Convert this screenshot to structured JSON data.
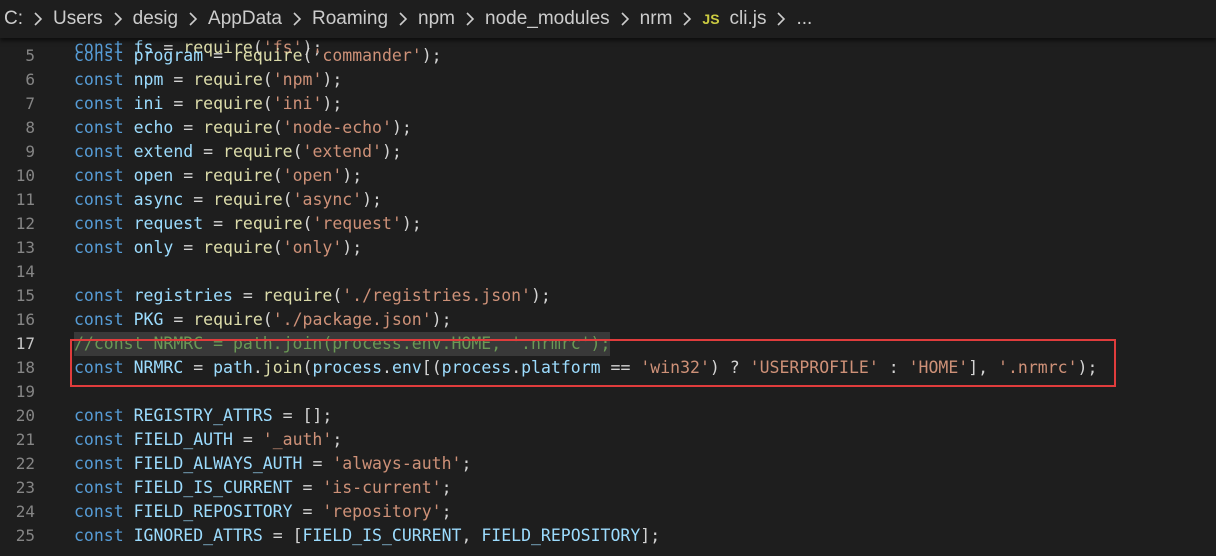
{
  "breadcrumb": {
    "segments": [
      "C:",
      "Users",
      "desig",
      "AppData",
      "Roaming",
      "npm",
      "node_modules",
      "nrm"
    ],
    "file_icon": "JS",
    "file_name": "cli.js",
    "trailing": "..."
  },
  "editor": {
    "active_line": 17,
    "highlighted_line": 18,
    "lines": [
      {
        "num": "5",
        "code": "const program = require('commander');"
      },
      {
        "num": "6",
        "code": "const npm = require('npm');"
      },
      {
        "num": "7",
        "code": "const ini = require('ini');"
      },
      {
        "num": "8",
        "code": "const echo = require('node-echo');"
      },
      {
        "num": "9",
        "code": "const extend = require('extend');"
      },
      {
        "num": "10",
        "code": "const open = require('open');"
      },
      {
        "num": "11",
        "code": "const async = require('async');"
      },
      {
        "num": "12",
        "code": "const request = require('request');"
      },
      {
        "num": "13",
        "code": "const only = require('only');"
      },
      {
        "num": "14",
        "code": ""
      },
      {
        "num": "15",
        "code": "const registries = require('./registries.json');"
      },
      {
        "num": "16",
        "code": "const PKG = require('./package.json');"
      },
      {
        "num": "17",
        "code": "//const NRMRC = path.join(process.env.HOME, '.nrmrc');"
      },
      {
        "num": "18",
        "code": "const NRMRC = path.join(process.env[(process.platform == 'win32') ? 'USERPROFILE' : 'HOME'], '.nrmrc');"
      },
      {
        "num": "19",
        "code": ""
      },
      {
        "num": "20",
        "code": "const REGISTRY_ATTRS = [];"
      },
      {
        "num": "21",
        "code": "const FIELD_AUTH = '_auth';"
      },
      {
        "num": "22",
        "code": "const FIELD_ALWAYS_AUTH = 'always-auth';"
      },
      {
        "num": "23",
        "code": "const FIELD_IS_CURRENT = 'is-current';"
      },
      {
        "num": "24",
        "code": "const FIELD_REPOSITORY = 'repository';"
      },
      {
        "num": "25",
        "code": "const IGNORED_ATTRS = [FIELD_IS_CURRENT, FIELD_REPOSITORY];"
      }
    ]
  },
  "colors": {
    "background": "#1e1e1e",
    "keyword": "#569cd6",
    "variable": "#9cdcfe",
    "function": "#dcdcaa",
    "string": "#ce9178",
    "comment": "#6a9955",
    "selection_border": "#e03c3c"
  }
}
